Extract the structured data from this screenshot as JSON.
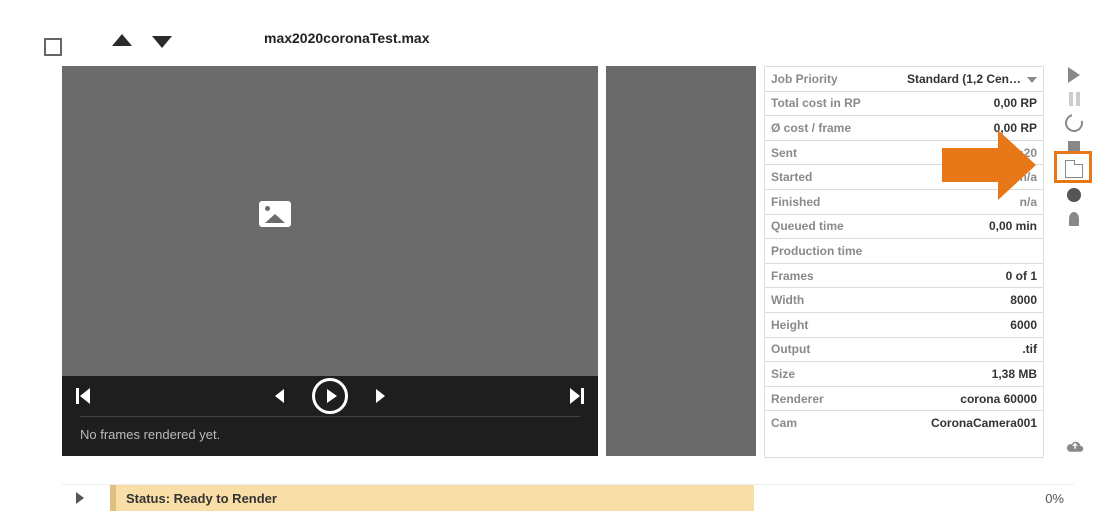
{
  "header": {
    "filename": "max2020coronaTest.max"
  },
  "player": {
    "status_text": "No frames rendered yet."
  },
  "info": {
    "priority": {
      "label": "Job Priority",
      "value": "Standard (1,2 Cen…"
    },
    "total_cost": {
      "label": "Total cost in RP",
      "value": "0,00 RP"
    },
    "avg_cost": {
      "label": "Ø cost / frame",
      "value": "0,00 RP"
    },
    "sent": {
      "label": "Sent",
      "value": "06.01.2021 09:20"
    },
    "started": {
      "label": "Started",
      "value": "n/a"
    },
    "finished": {
      "label": "Finished",
      "value": "n/a"
    },
    "queued": {
      "label": "Queued time",
      "value": "0,00 min"
    },
    "prod": {
      "label": "Production time",
      "value": ""
    },
    "frames": {
      "label": "Frames",
      "value": "0 of 1"
    },
    "width": {
      "label": "Width",
      "value": "8000"
    },
    "height": {
      "label": "Height",
      "value": "6000"
    },
    "output": {
      "label": "Output",
      "value": ".tif"
    },
    "size": {
      "label": "Size",
      "value": "1,38 MB"
    },
    "renderer": {
      "label": "Renderer",
      "value": "corona 60000"
    },
    "cam": {
      "label": "Cam",
      "value": "CoronaCamera001"
    }
  },
  "status_bar": {
    "label": "Status: Ready to Render",
    "progress": "0%"
  }
}
